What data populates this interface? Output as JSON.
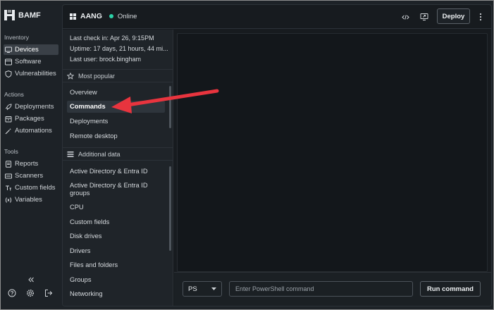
{
  "brand": {
    "name": "BAMF"
  },
  "nav": {
    "sections": [
      {
        "title": "Inventory",
        "items": [
          {
            "label": "Devices",
            "icon": "monitor-icon",
            "active": true
          },
          {
            "label": "Software",
            "icon": "window-icon"
          },
          {
            "label": "Vulnerabilities",
            "icon": "shield-icon"
          }
        ]
      },
      {
        "title": "Actions",
        "items": [
          {
            "label": "Deployments",
            "icon": "rocket-icon"
          },
          {
            "label": "Packages",
            "icon": "package-icon"
          },
          {
            "label": "Automations",
            "icon": "magic-wand-icon"
          }
        ]
      },
      {
        "title": "Tools",
        "items": [
          {
            "label": "Reports",
            "icon": "report-icon"
          },
          {
            "label": "Scanners",
            "icon": "scanner-icon"
          },
          {
            "label": "Custom fields",
            "icon": "text-field-icon"
          },
          {
            "label": "Variables",
            "icon": "variable-icon"
          }
        ]
      }
    ]
  },
  "device": {
    "name": "AANG",
    "status": "Online",
    "status_color": "#2bd1a7"
  },
  "header": {
    "deploy_label": "Deploy"
  },
  "meta": {
    "last_checkin": "Last check in: Apr 26, 9:15PM",
    "uptime": "Uptime: 17 days, 21 hours, 44 mi...",
    "last_user": "Last user: brock.bingham"
  },
  "most_popular": {
    "title": "Most popular",
    "items": [
      "Overview",
      "Commands",
      "Deployments",
      "Remote desktop"
    ],
    "selected": "Commands"
  },
  "additional_data": {
    "title": "Additional data",
    "items": [
      "Active Directory & Entra ID",
      "Active Directory & Entra ID groups",
      "CPU",
      "Custom fields",
      "Disk drives",
      "Drivers",
      "Files and folders",
      "Groups",
      "Networking"
    ]
  },
  "command_bar": {
    "shell": "PS",
    "placeholder": "Enter PowerShell command",
    "run_label": "Run command"
  },
  "annotation": {
    "arrow_color": "#e8343e"
  }
}
